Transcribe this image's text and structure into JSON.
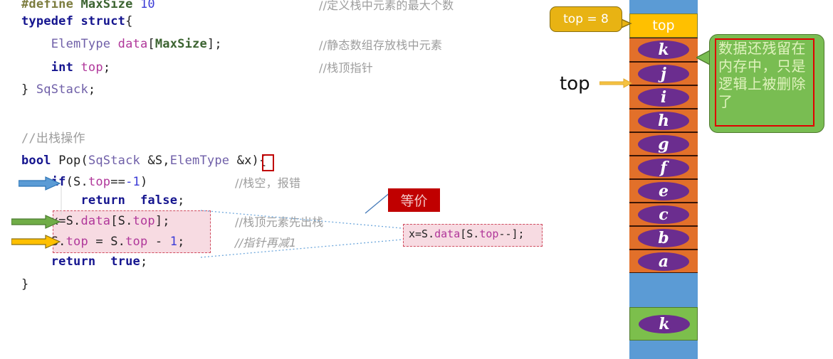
{
  "code": {
    "lines": [
      {
        "id": "l1",
        "segs": [
          {
            "t": "#define ",
            "c": "mac"
          },
          {
            "t": "MaxSize",
            "c": "macn"
          },
          {
            "t": " ",
            "c": "pl"
          },
          {
            "t": "10",
            "c": "num"
          }
        ],
        "comment": "//定义栈中元素的最大个数"
      },
      {
        "id": "l2",
        "segs": [
          {
            "t": "typedef struct",
            "c": "kw"
          },
          {
            "t": "{",
            "c": "pl"
          }
        ],
        "comment": ""
      },
      {
        "id": "l3",
        "segs": [
          {
            "t": "    ",
            "c": "pl"
          },
          {
            "t": "ElemType",
            "c": "tp"
          },
          {
            "t": " ",
            "c": "pl"
          },
          {
            "t": "data",
            "c": "mem"
          },
          {
            "t": "[",
            "c": "pl"
          },
          {
            "t": "MaxSize",
            "c": "macn"
          },
          {
            "t": "];",
            "c": "pl"
          }
        ],
        "comment": "//静态数组存放栈中元素"
      },
      {
        "id": "l4",
        "segs": [
          {
            "t": "    ",
            "c": "pl"
          },
          {
            "t": "int",
            "c": "kw"
          },
          {
            "t": " ",
            "c": "pl"
          },
          {
            "t": "top",
            "c": "mem"
          },
          {
            "t": ";",
            "c": "pl"
          }
        ],
        "comment": "//栈顶指针"
      },
      {
        "id": "l5",
        "segs": [
          {
            "t": "} ",
            "c": "pl"
          },
          {
            "t": "SqStack",
            "c": "tp"
          },
          {
            "t": ";",
            "c": "pl"
          }
        ],
        "comment": ""
      },
      {
        "id": "l6",
        "segs": [
          {
            "t": "//出栈操作",
            "c": "cmt-mono"
          }
        ],
        "comment": ""
      },
      {
        "id": "l7",
        "segs": [
          {
            "t": "bool",
            "c": "kw"
          },
          {
            "t": " ",
            "c": "pl"
          },
          {
            "t": "Pop",
            "c": "fn"
          },
          {
            "t": "(",
            "c": "pl"
          },
          {
            "t": "SqStack",
            "c": "tp"
          },
          {
            "t": " &S,",
            "c": "pl"
          },
          {
            "t": "ElemType",
            "c": "tp"
          },
          {
            "t": " &x){",
            "c": "pl"
          }
        ],
        "comment": ""
      },
      {
        "id": "l8",
        "segs": [
          {
            "t": "    ",
            "c": "pl"
          },
          {
            "t": "if",
            "c": "kw"
          },
          {
            "t": "(S.",
            "c": "pl"
          },
          {
            "t": "top",
            "c": "mem"
          },
          {
            "t": "==",
            "c": "pl"
          },
          {
            "t": "-1",
            "c": "num"
          },
          {
            "t": ")",
            "c": "pl"
          }
        ],
        "comment": "//栈空，报错"
      },
      {
        "id": "l9",
        "segs": [
          {
            "t": "        ",
            "c": "pl"
          },
          {
            "t": "return  false",
            "c": "kw"
          },
          {
            "t": ";",
            "c": "pl"
          }
        ],
        "comment": ""
      },
      {
        "id": "l10",
        "segs": [
          {
            "t": "    x=S.",
            "c": "pl"
          },
          {
            "t": "data",
            "c": "mem"
          },
          {
            "t": "[S.",
            "c": "pl"
          },
          {
            "t": "top",
            "c": "mem"
          },
          {
            "t": "];",
            "c": "pl"
          }
        ],
        "comment": "//栈顶元素先出栈"
      },
      {
        "id": "l11",
        "segs": [
          {
            "t": "    S.",
            "c": "pl"
          },
          {
            "t": "top",
            "c": "mem"
          },
          {
            "t": " = S.",
            "c": "pl"
          },
          {
            "t": "top",
            "c": "mem"
          },
          {
            "t": " - ",
            "c": "pl"
          },
          {
            "t": "1",
            "c": "num"
          },
          {
            "t": ";",
            "c": "pl"
          }
        ],
        "comment": "//指针再减1"
      },
      {
        "id": "l12",
        "segs": [
          {
            "t": "    ",
            "c": "pl"
          },
          {
            "t": "return  true",
            "c": "kw"
          },
          {
            "t": ";",
            "c": "pl"
          }
        ],
        "comment": ""
      },
      {
        "id": "l13",
        "segs": [
          {
            "t": "}",
            "c": "pl"
          }
        ],
        "comment": ""
      }
    ],
    "equivalent_label": "等价",
    "equivalent_code": "x=S.data[S.top--];",
    "arrows": [
      {
        "name": "arrow-if-line",
        "color": "#5b9bd5"
      },
      {
        "name": "arrow-assign-line",
        "color": "#70ad47"
      },
      {
        "name": "arrow-decrement-line",
        "color": "#ffc000"
      }
    ]
  },
  "stack": {
    "top_callout": "top = 8",
    "top_pointer_label": "top",
    "top_cell_label": "top",
    "cells": [
      {
        "kind": "blue",
        "label": ""
      },
      {
        "kind": "yellow",
        "label": "top"
      },
      {
        "kind": "orange",
        "label": "k"
      },
      {
        "kind": "orange",
        "label": "j"
      },
      {
        "kind": "orange",
        "label": "i"
      },
      {
        "kind": "orange",
        "label": "h"
      },
      {
        "kind": "orange",
        "label": "g"
      },
      {
        "kind": "orange",
        "label": "f"
      },
      {
        "kind": "orange",
        "label": "e"
      },
      {
        "kind": "orange",
        "label": "c"
      },
      {
        "kind": "orange",
        "label": "b"
      },
      {
        "kind": "orange",
        "label": "a"
      },
      {
        "kind": "blue",
        "label": ""
      },
      {
        "kind": "green",
        "label": "k"
      },
      {
        "kind": "blue",
        "label": ""
      }
    ],
    "note": "数据还残留在内存中，只是逻辑上被删除了"
  },
  "colors": {
    "orange_cell": "#e2702a",
    "blue_cell": "#5b9bd5",
    "yellow_cell": "#ffc000",
    "green_cell": "#7cbf4c",
    "ellipse": "#6b2d8f",
    "note_bubble": "#79bd52",
    "note_border": "#e00000",
    "equiv_label_bg": "#c00000",
    "highlight_pink": "#f7dbe2",
    "highlight_border": "#cf4b5e"
  }
}
